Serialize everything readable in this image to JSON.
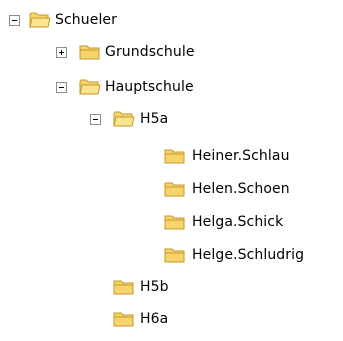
{
  "tree": {
    "root": {
      "label": "Schueler",
      "state": "expanded",
      "icon": "folder-open-icon"
    },
    "grundschule": {
      "label": "Grundschule",
      "state": "collapsed",
      "icon": "folder-closed-icon"
    },
    "hauptschule": {
      "label": "Hauptschule",
      "state": "expanded",
      "icon": "folder-open-icon"
    },
    "h5a": {
      "label": "H5a",
      "state": "expanded",
      "icon": "folder-open-icon"
    },
    "h5a_items": [
      {
        "label": "Heiner.Schlau",
        "icon": "folder-closed-icon"
      },
      {
        "label": "Helen.Schoen",
        "icon": "folder-closed-icon"
      },
      {
        "label": "Helga.Schick",
        "icon": "folder-closed-icon"
      },
      {
        "label": "Helge.Schludrig",
        "icon": "folder-closed-icon"
      }
    ],
    "h5b": {
      "label": "H5b",
      "icon": "folder-closed-icon"
    },
    "h6a": {
      "label": "H6a",
      "icon": "folder-closed-icon"
    }
  },
  "colors": {
    "folder_fill": "#f7d36b",
    "folder_stroke": "#c59a2c",
    "toggle_border": "#8c8c8c"
  }
}
